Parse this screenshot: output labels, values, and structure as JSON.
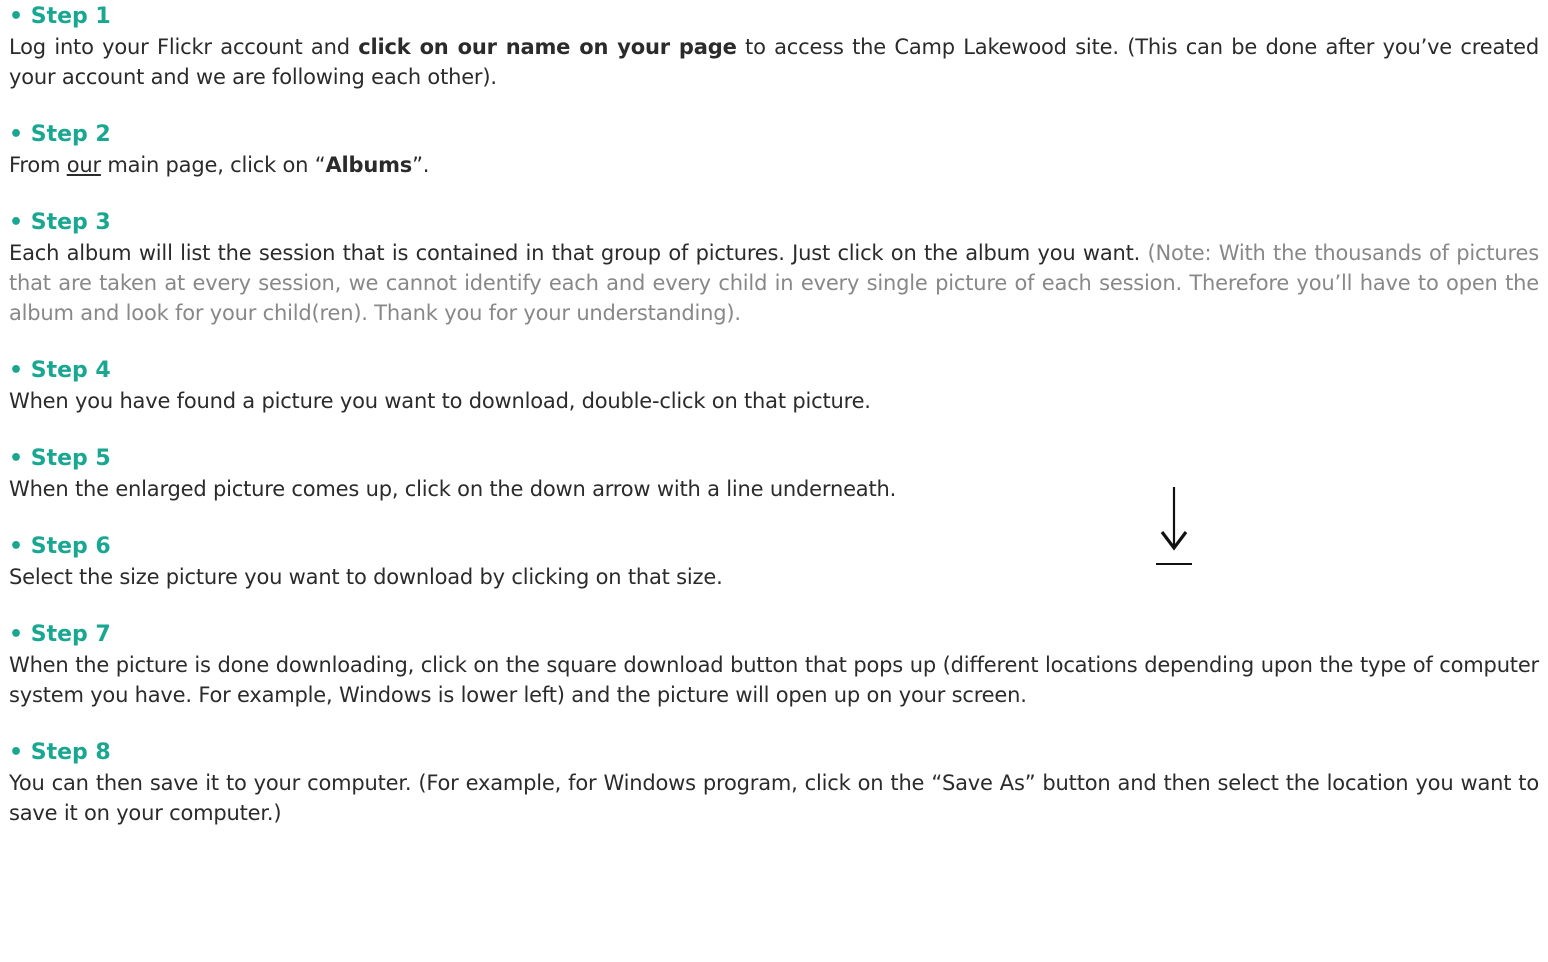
{
  "steps": [
    {
      "heading": "• Step 1",
      "parts": [
        {
          "t": "Log into your Flickr account and ",
          "s": ""
        },
        {
          "t": "click on our name on your page",
          "s": "b"
        },
        {
          "t": " to access the Camp Lakewood site. (This can be done after you’ve created your account and we are following each other).",
          "s": ""
        }
      ]
    },
    {
      "heading": "• Step 2",
      "parts": [
        {
          "t": "From ",
          "s": ""
        },
        {
          "t": "our",
          "s": "u"
        },
        {
          "t": " main page, click on “",
          "s": ""
        },
        {
          "t": "Albums",
          "s": "b"
        },
        {
          "t": "”.",
          "s": ""
        }
      ]
    },
    {
      "heading": "• Step 3",
      "parts": [
        {
          "t": "Each album will list the session that is contained in that group of pictures.  Just click on the album you want. ",
          "s": ""
        },
        {
          "t": "(Note: With the thousands of pictures that are taken at every session, we cannot identify each and every child in every single picture of each session. Therefore you’ll have to open the album and look for your child(ren). Thank you for your understanding).",
          "s": "note"
        }
      ]
    },
    {
      "heading": "• Step 4",
      "parts": [
        {
          "t": "When you have found a picture you want to download, double-click on that picture.",
          "s": ""
        }
      ]
    },
    {
      "heading": "• Step 5",
      "parts": [
        {
          "t": "When the enlarged picture comes up, click on the down arrow with a line underneath.",
          "s": ""
        }
      ]
    },
    {
      "heading": "• Step 6",
      "parts": [
        {
          "t": "Select the size picture you want to download by clicking on that size.",
          "s": ""
        }
      ]
    },
    {
      "heading": "• Step 7",
      "parts": [
        {
          "t": "When the picture is done downloading, click on the square download button that pops up (different locations depending upon the type of computer system you have. For example, Windows is lower left) and the picture will open up on your screen.",
          "s": ""
        }
      ]
    },
    {
      "heading": "• Step 8",
      "parts": [
        {
          "t": "You can then save it to your computer. (For example, for Windows program, click on the “Save As” button and then select the location you want to save it on your computer.)",
          "s": ""
        }
      ]
    }
  ],
  "icons": {
    "download_arrow": "download-arrow-icon"
  },
  "colors": {
    "heading": "#1aa792",
    "body": "#2b2b2b",
    "note": "#888888"
  }
}
